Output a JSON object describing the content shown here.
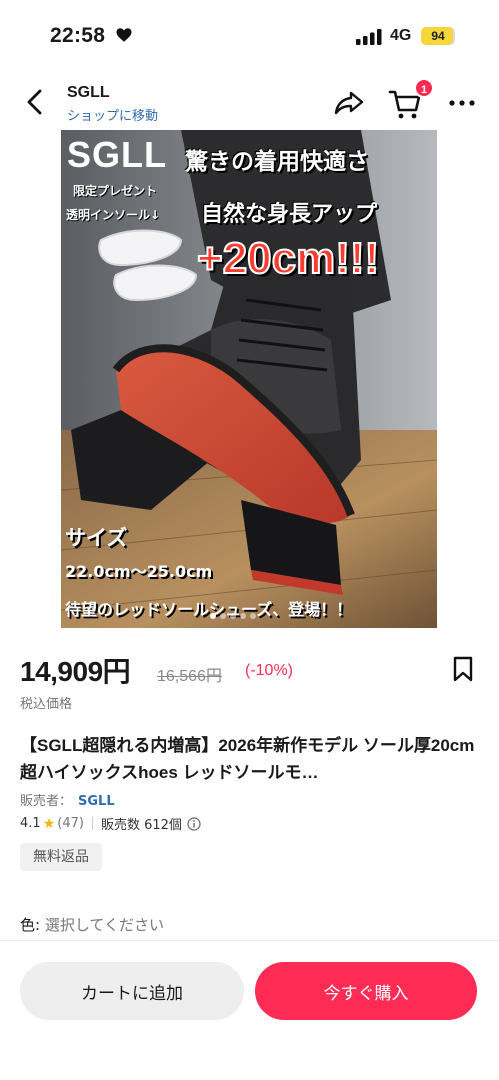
{
  "status_bar": {
    "time": "22:58",
    "network": "4G",
    "battery": "94",
    "battery_level": 0.94
  },
  "header": {
    "shop_name": "SGLL",
    "shop_link": "ショップに移動",
    "cart_count": "1"
  },
  "product_image": {
    "brand": "SGLL",
    "headline": "驚きの着用快適さ",
    "gift_line1": "限定プレゼント",
    "gift_line2": "透明インソール↓",
    "height_claim": "自然な身長アップ",
    "height_value": "+20cm!!!",
    "size_label": "サイズ",
    "size_range": "22.0cm～25.0cm",
    "tagline": "待望のレッドソールシューズ、登場！！"
  },
  "price": {
    "current": "14,909円",
    "original": "16,566円",
    "discount": "(-10%)",
    "tax_note": "税込価格"
  },
  "product": {
    "title": "【SGLL超隠れる内増高】2026年新作モデル ソール厚20cm 超ハイソックスhoes レッドソールモ…",
    "seller_label": "販売者：",
    "seller_name": "SGLL",
    "rating": "4.1",
    "review_count": "(47)",
    "sold": "販売数 612個",
    "free_return": "無料返品"
  },
  "variant": {
    "color_label": "色:",
    "color_placeholder": "選択してください"
  },
  "actions": {
    "add_to_cart": "カートに追加",
    "buy_now": "今すぐ購入"
  },
  "colors": {
    "accent": "#fe2c55",
    "link": "#2f6db3",
    "star": "#f7b500"
  }
}
